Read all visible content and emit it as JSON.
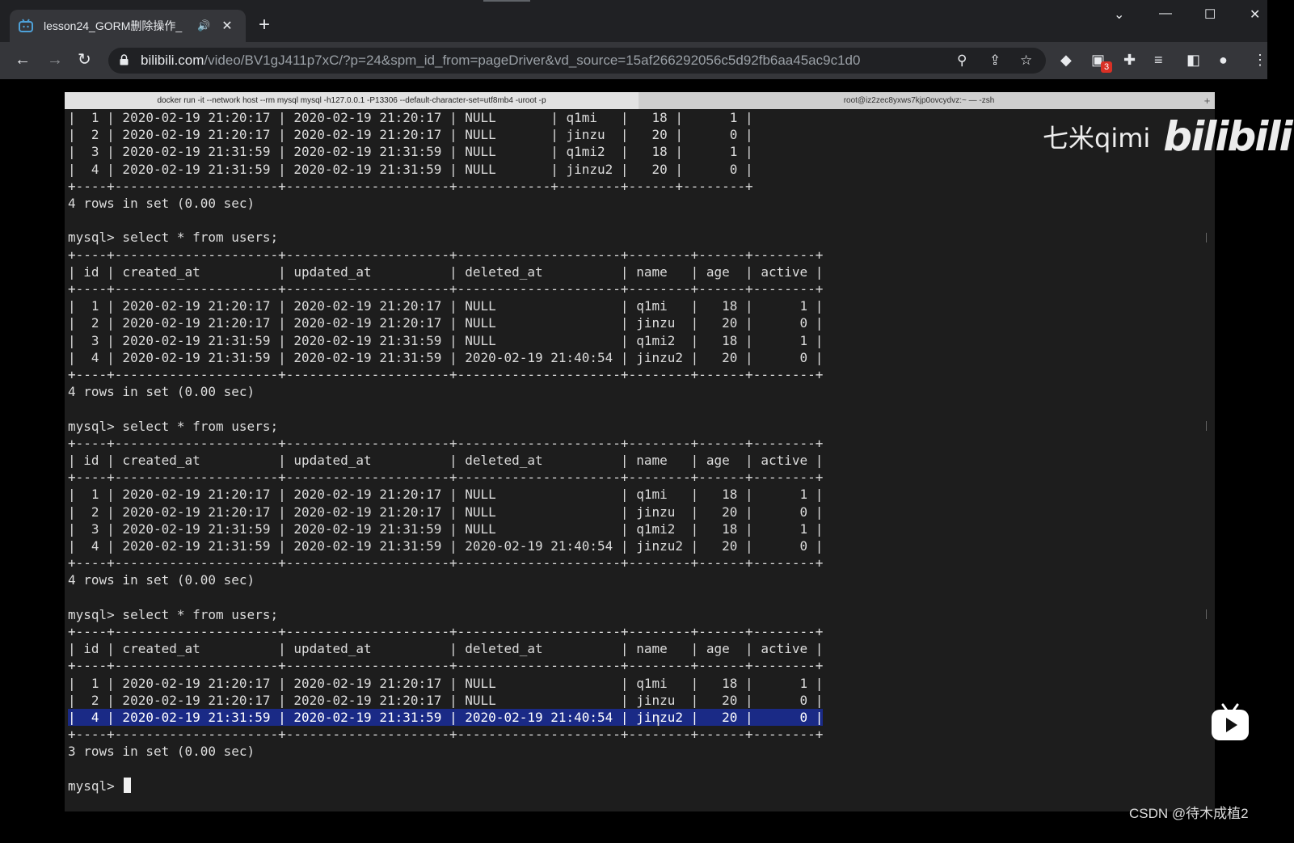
{
  "browser": {
    "tab_title": "lesson24_GORM删除操作_",
    "tab_audio_icon": "speaker-icon",
    "new_tab_label": "+",
    "url_host": "bilibili.com",
    "url_path": "/video/BV1gJ411p7xC/?p=24&spm_id_from=pageDriver&vd_source=15af266292056c5d92fb6aa45ac9c1d0",
    "extension_badge": "3"
  },
  "terminal": {
    "tab1_title": "docker run -it --network host --rm mysql mysql -h127.0.0.1 -P13306 --default-character-set=utf8mb4 -uroot -p",
    "tab2_title": "root@iz2zec8yxws7kjp0ovcydvz:~ — -zsh",
    "lines": [
      "|  1 | 2020-02-19 21:20:17 | 2020-02-19 21:20:17 | NULL       | q1mi   |   18 |      1 |",
      "|  2 | 2020-02-19 21:20:17 | 2020-02-19 21:20:17 | NULL       | jinzu  |   20 |      0 |",
      "|  3 | 2020-02-19 21:31:59 | 2020-02-19 21:31:59 | NULL       | q1mi2  |   18 |      1 |",
      "|  4 | 2020-02-19 21:31:59 | 2020-02-19 21:31:59 | NULL       | jinzu2 |   20 |      0 |",
      "+----+---------------------+---------------------+------------+--------+------+--------+",
      "4 rows in set (0.00 sec)",
      "",
      "mysql> select * from users;",
      "+----+---------------------+---------------------+---------------------+--------+------+--------+",
      "| id | created_at          | updated_at          | deleted_at          | name   | age  | active |",
      "+----+---------------------+---------------------+---------------------+--------+------+--------+",
      "|  1 | 2020-02-19 21:20:17 | 2020-02-19 21:20:17 | NULL                | q1mi   |   18 |      1 |",
      "|  2 | 2020-02-19 21:20:17 | 2020-02-19 21:20:17 | NULL                | jinzu  |   20 |      0 |",
      "|  3 | 2020-02-19 21:31:59 | 2020-02-19 21:31:59 | NULL                | q1mi2  |   18 |      1 |",
      "|  4 | 2020-02-19 21:31:59 | 2020-02-19 21:31:59 | 2020-02-19 21:40:54 | jinzu2 |   20 |      0 |",
      "+----+---------------------+---------------------+---------------------+--------+------+--------+",
      "4 rows in set (0.00 sec)",
      "",
      "mysql> select * from users;",
      "+----+---------------------+---------------------+---------------------+--------+------+--------+",
      "| id | created_at          | updated_at          | deleted_at          | name   | age  | active |",
      "+----+---------------------+---------------------+---------------------+--------+------+--------+",
      "|  1 | 2020-02-19 21:20:17 | 2020-02-19 21:20:17 | NULL                | q1mi   |   18 |      1 |",
      "|  2 | 2020-02-19 21:20:17 | 2020-02-19 21:20:17 | NULL                | jinzu  |   20 |      0 |",
      "|  3 | 2020-02-19 21:31:59 | 2020-02-19 21:31:59 | NULL                | q1mi2  |   18 |      1 |",
      "|  4 | 2020-02-19 21:31:59 | 2020-02-19 21:31:59 | 2020-02-19 21:40:54 | jinzu2 |   20 |      0 |",
      "+----+---------------------+---------------------+---------------------+--------+------+--------+",
      "4 rows in set (0.00 sec)",
      "",
      "mysql> select * from users;",
      "+----+---------------------+---------------------+---------------------+--------+------+--------+",
      "| id | created_at          | updated_at          | deleted_at          | name   | age  | active |",
      "+----+---------------------+---------------------+---------------------+--------+------+--------+",
      "|  1 | 2020-02-19 21:20:17 | 2020-02-19 21:20:17 | NULL                | q1mi   |   18 |      1 |",
      "|  2 | 2020-02-19 21:20:17 | 2020-02-19 21:20:17 | NULL                | jinzu  |   20 |      0 |",
      "|  4 | 2020-02-19 21:31:59 | 2020-02-19 21:31:59 | 2020-02-19 21:40:54 | jinzu2 |   20 |      0 |",
      "+----+---------------------+---------------------+---------------------+--------+------+--------+",
      "3 rows in set (0.00 sec)",
      "",
      "mysql> "
    ],
    "highlighted_line": 35
  },
  "overlay": {
    "watermark_text": "七米qimi",
    "watermark_logo": "bilibili",
    "csdn_credit": "CSDN @待木成植2"
  }
}
